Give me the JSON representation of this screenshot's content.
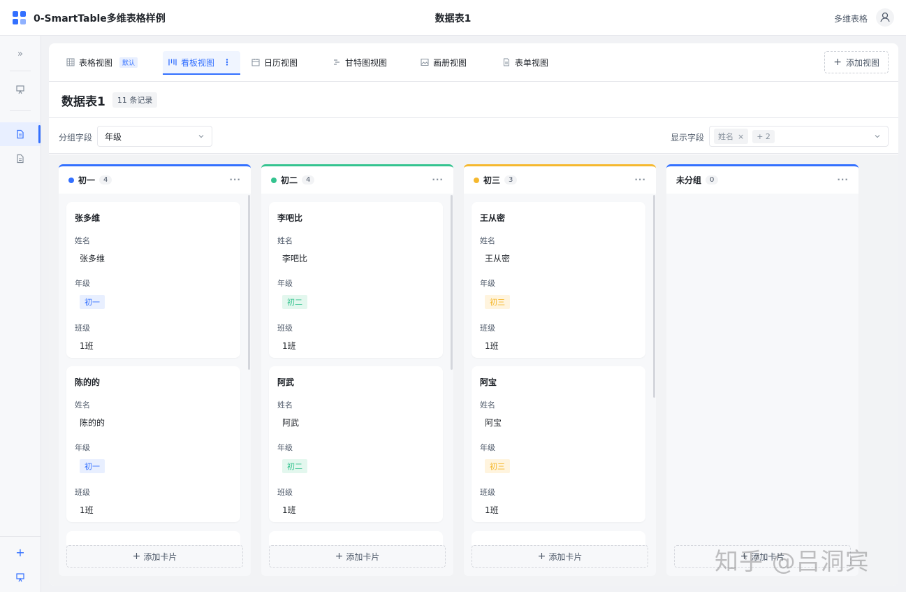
{
  "app": {
    "title": "0-SmartTable多维表格样例",
    "page_title": "数据表1",
    "top_right_label": "多维表格"
  },
  "colors": {
    "accent": "#3370ff",
    "grade1": "#3370ff",
    "grade2": "#34c38f",
    "grade3": "#f5b82e",
    "ungrouped": "#3370ff"
  },
  "views": {
    "tabs": [
      {
        "label": "表格视图",
        "icon": "grid-icon",
        "badge": "默认"
      },
      {
        "label": "看板视图",
        "icon": "kanban-icon",
        "more": "⋮"
      },
      {
        "label": "日历视图",
        "icon": "calendar-icon"
      },
      {
        "label": "甘特图视图",
        "icon": "gantt-icon"
      },
      {
        "label": "画册视图",
        "icon": "image-icon"
      },
      {
        "label": "表单视图",
        "icon": "form-icon"
      }
    ],
    "add_label": "添加视图"
  },
  "table": {
    "name": "数据表1",
    "record_count": "11 条记录"
  },
  "toolbar": {
    "group_label": "分组字段",
    "group_value": "年级",
    "display_label": "显示字段",
    "display_tag": "姓名",
    "display_more": "+ 2"
  },
  "board": {
    "add_card_label": "添加卡片",
    "columns": [
      {
        "name": "初一",
        "count": "4",
        "cards": [
          {
            "title": "张多维",
            "fields": {
              "name_label": "姓名",
              "name": "张多维",
              "grade_label": "年级",
              "grade": "初一",
              "class_label": "班级",
              "class": "1班"
            }
          },
          {
            "title": "陈的的",
            "fields": {
              "name_label": "姓名",
              "name": "陈的的",
              "grade_label": "年级",
              "grade": "初一",
              "class_label": "班级",
              "class": "1班"
            }
          }
        ]
      },
      {
        "name": "初二",
        "count": "4",
        "cards": [
          {
            "title": "李吧比",
            "fields": {
              "name_label": "姓名",
              "name": "李吧比",
              "grade_label": "年级",
              "grade": "初二",
              "class_label": "班级",
              "class": "1班"
            }
          },
          {
            "title": "阿武",
            "fields": {
              "name_label": "姓名",
              "name": "阿武",
              "grade_label": "年级",
              "grade": "初二",
              "class_label": "班级",
              "class": "1班"
            }
          }
        ]
      },
      {
        "name": "初三",
        "count": "3",
        "cards": [
          {
            "title": "王从密",
            "fields": {
              "name_label": "姓名",
              "name": "王从密",
              "grade_label": "年级",
              "grade": "初三",
              "class_label": "班级",
              "class": "1班"
            }
          },
          {
            "title": "阿宝",
            "fields": {
              "name_label": "姓名",
              "name": "阿宝",
              "grade_label": "年级",
              "grade": "初三",
              "class_label": "班级",
              "class": "1班"
            }
          }
        ]
      },
      {
        "name": "未分组",
        "count": "0",
        "cards": []
      }
    ]
  },
  "watermark": "知乎 @吕洞宾"
}
